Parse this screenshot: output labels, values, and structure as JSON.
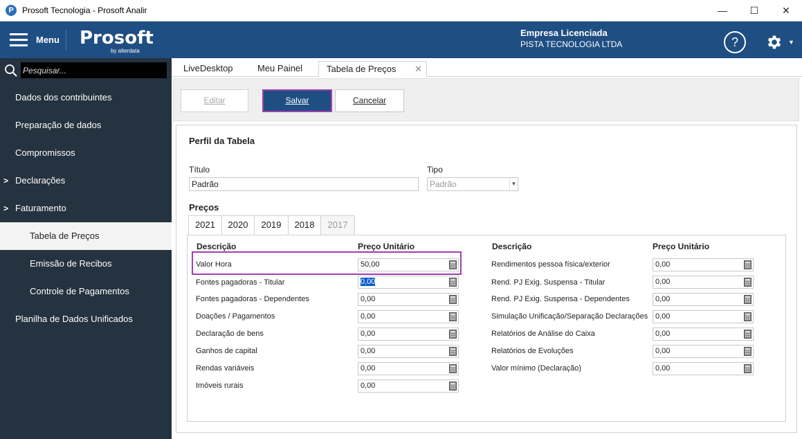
{
  "window": {
    "title": "Prosoft Tecnologia - Prosoft Analir",
    "minimize": "—",
    "maximize": "☐",
    "close": "✕"
  },
  "header": {
    "menu_label": "Menu",
    "logo": "Prosoft",
    "logo_sub": "by alterdata",
    "company_label": "Empresa Licenciada",
    "company_name": "PISTA TECNOLOGIA LTDA",
    "help": "?"
  },
  "sidebar": {
    "search_placeholder": "Pesquisar...",
    "items": [
      {
        "label": "Dados dos contribuintes"
      },
      {
        "label": "Preparação de dados"
      },
      {
        "label": "Compromissos"
      },
      {
        "label": "Declarações",
        "chevron": ">"
      },
      {
        "label": "Faturamento",
        "chevron": ">"
      },
      {
        "label": "Tabela de Preços"
      },
      {
        "label": "Emissão de Recibos"
      },
      {
        "label": "Controle de Pagamentos"
      },
      {
        "label": "Planilha de Dados Unificados"
      }
    ]
  },
  "tabs": [
    {
      "label": "LiveDesktop"
    },
    {
      "label": "Meu Painel"
    },
    {
      "label": "Tabela de Preços",
      "close": "✕"
    }
  ],
  "toolbar": {
    "edit": "Editar",
    "save": "Salvar",
    "cancel": "Cancelar"
  },
  "form": {
    "section_title": "Perfil da Tabela",
    "titulo_label": "Título",
    "titulo_value": "Padrão",
    "tipo_label": "Tipo",
    "tipo_value": "Padrão",
    "precos_label": "Preços",
    "years": [
      "2021",
      "2020",
      "2019",
      "2018",
      "2017"
    ],
    "col_desc": "Descrição",
    "col_price": "Preço Unitário",
    "left_rows": [
      {
        "label": "Valor Hora",
        "value": "50,00"
      },
      {
        "label": "Fontes pagadoras - Titular",
        "value": "0,00"
      },
      {
        "label": "Fontes pagadoras - Dependentes",
        "value": "0,00"
      },
      {
        "label": "Doações / Pagamentos",
        "value": "0,00"
      },
      {
        "label": "Declaração de bens",
        "value": "0,00"
      },
      {
        "label": "Ganhos de capital",
        "value": "0,00"
      },
      {
        "label": "Rendas variáveis",
        "value": "0,00"
      },
      {
        "label": "Imóveis rurais",
        "value": "0,00"
      }
    ],
    "right_rows": [
      {
        "label": "Rendimentos pessoa física/exterior",
        "value": "0,00"
      },
      {
        "label": "Rend. PJ Exig. Suspensa - Titular",
        "value": "0,00"
      },
      {
        "label": "Rend. PJ Exig. Suspensa - Dependentes",
        "value": "0,00"
      },
      {
        "label": "Simulação Unificação/Separação Declarações",
        "value": "0,00"
      },
      {
        "label": "Relatórios de Análise do Caixa",
        "value": "0,00"
      },
      {
        "label": "Relatórios de Evoluções",
        "value": "0,00"
      },
      {
        "label": "Valor mínimo (Declaração)",
        "value": "0,00"
      }
    ]
  },
  "colors": {
    "header_bg": "#1f4e82",
    "sidebar_bg": "#25323f",
    "highlight": "#a040b0"
  }
}
